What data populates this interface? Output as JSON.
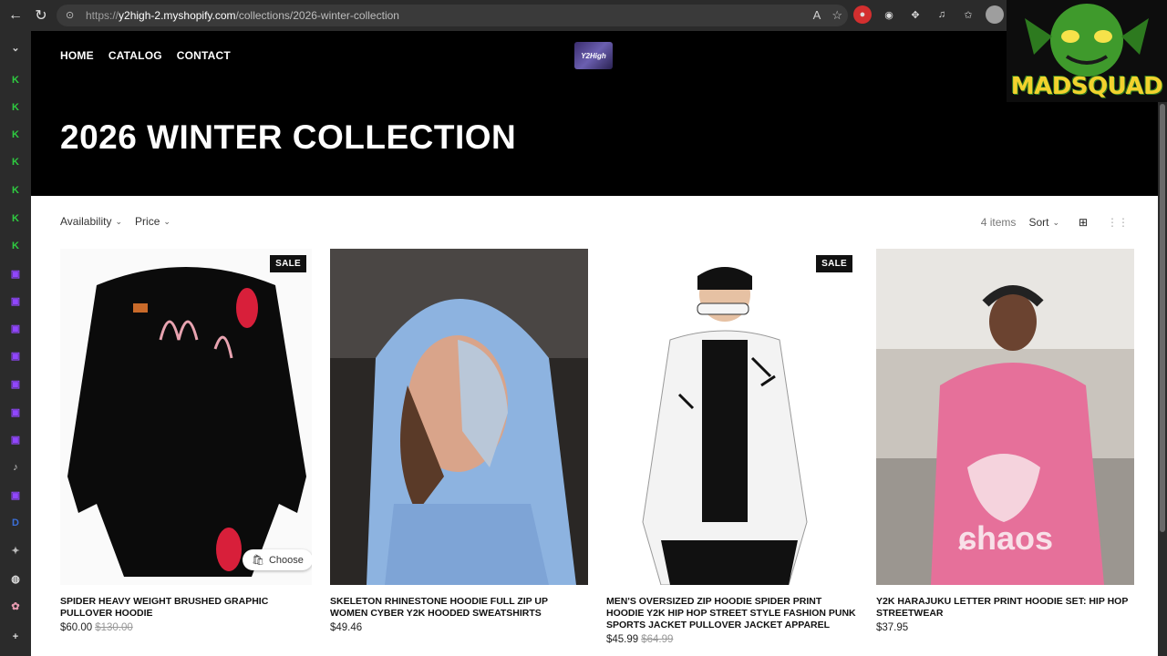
{
  "browser": {
    "url_scheme": "https://",
    "url_host": "y2high-2.myshopify.com",
    "url_path": "/collections/2026-winter-collection"
  },
  "store": {
    "nav": [
      "HOME",
      "CATALOG",
      "CONTACT"
    ],
    "logo_text": "Y2High",
    "collection_title": "2026 WINTER COLLECTION"
  },
  "toolbar": {
    "availability": "Availability",
    "price": "Price",
    "count": "4 items",
    "sort": "Sort"
  },
  "products": [
    {
      "title": "SPIDER HEAVY WEIGHT BRUSHED GRAPHIC PULLOVER HOODIE",
      "price": "$60.00",
      "old_price": "$130.00",
      "sale": "SALE"
    },
    {
      "title": "SKELETON RHINESTONE HOODIE FULL ZIP UP WOMEN CYBER Y2K HOODED SWEATSHIRTS",
      "price": "$49.46",
      "old_price": "",
      "sale": ""
    },
    {
      "title": "MEN'S OVERSIZED ZIP HOODIE SPIDER PRINT HOODIE Y2K HIP HOP STREET STYLE FASHION PUNK SPORTS JACKET PULLOVER JACKET APPAREL",
      "price": "$45.99",
      "old_price": "$64.99",
      "sale": "SALE"
    },
    {
      "title": "Y2K HARAJUKU LETTER PRINT HOODIE SET: HIP HOP STREETWEAR",
      "price": "$37.95",
      "old_price": "",
      "sale": ""
    }
  ],
  "quick_add": "Choose",
  "overlay": {
    "text": "MADSQUAD"
  },
  "colors": {
    "hero": "#000000",
    "sale_badge": "#111111",
    "accent_green": "#2ecc40",
    "twitch_purple": "#9146ff"
  }
}
